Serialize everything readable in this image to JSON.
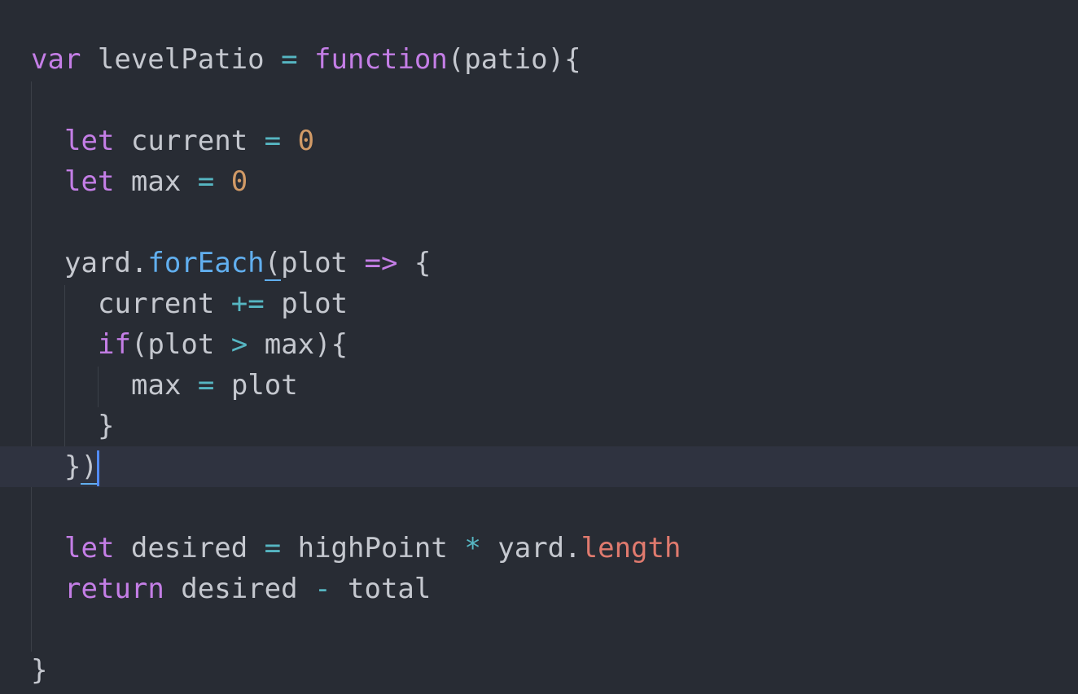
{
  "editor": {
    "lines": [
      [
        {
          "t": "var",
          "c": "kw"
        },
        {
          "t": " levelPatio ",
          "c": "id"
        },
        {
          "t": "=",
          "c": "op"
        },
        {
          "t": " ",
          "c": "id"
        },
        {
          "t": "function",
          "c": "kw"
        },
        {
          "t": "(patio){",
          "c": "punc"
        }
      ],
      [],
      [
        {
          "t": "let",
          "c": "kw"
        },
        {
          "t": " current ",
          "c": "id"
        },
        {
          "t": "=",
          "c": "op"
        },
        {
          "t": " ",
          "c": "id"
        },
        {
          "t": "0",
          "c": "num"
        }
      ],
      [
        {
          "t": "let",
          "c": "kw"
        },
        {
          "t": " max ",
          "c": "id"
        },
        {
          "t": "=",
          "c": "op"
        },
        {
          "t": " ",
          "c": "id"
        },
        {
          "t": "0",
          "c": "num"
        }
      ],
      [],
      [
        {
          "t": "yard.",
          "c": "id"
        },
        {
          "t": "forEach",
          "c": "fn"
        },
        {
          "t": "(",
          "c": "punc",
          "match": true
        },
        {
          "t": "plot ",
          "c": "id"
        },
        {
          "t": "=>",
          "c": "kw"
        },
        {
          "t": " {",
          "c": "punc"
        }
      ],
      [
        {
          "t": "current ",
          "c": "id"
        },
        {
          "t": "+=",
          "c": "op"
        },
        {
          "t": " plot",
          "c": "id"
        }
      ],
      [
        {
          "t": "if",
          "c": "kw"
        },
        {
          "t": "(plot ",
          "c": "id"
        },
        {
          "t": ">",
          "c": "op"
        },
        {
          "t": " max){",
          "c": "id"
        }
      ],
      [
        {
          "t": "max ",
          "c": "id"
        },
        {
          "t": "=",
          "c": "op"
        },
        {
          "t": " plot",
          "c": "id"
        }
      ],
      [
        {
          "t": "}",
          "c": "punc"
        }
      ],
      [
        {
          "t": "}",
          "c": "punc"
        },
        {
          "t": ")",
          "c": "punc",
          "match": true
        }
      ],
      [],
      [
        {
          "t": "let",
          "c": "kw"
        },
        {
          "t": " desired ",
          "c": "id"
        },
        {
          "t": "=",
          "c": "op"
        },
        {
          "t": " highPoint ",
          "c": "id"
        },
        {
          "t": "*",
          "c": "op"
        },
        {
          "t": " yard.",
          "c": "id"
        },
        {
          "t": "length",
          "c": "prop"
        }
      ],
      [
        {
          "t": "return",
          "c": "kw"
        },
        {
          "t": " desired ",
          "c": "id"
        },
        {
          "t": "-",
          "c": "op"
        },
        {
          "t": " total",
          "c": "id"
        }
      ],
      [],
      [
        {
          "t": "}",
          "c": "punc"
        }
      ]
    ],
    "indent_levels": [
      0,
      0,
      1,
      1,
      0,
      1,
      2,
      2,
      3,
      2,
      1,
      0,
      1,
      1,
      0,
      0
    ],
    "active_line": 10,
    "cursor_line": 10,
    "cursor_after_token": 1
  }
}
